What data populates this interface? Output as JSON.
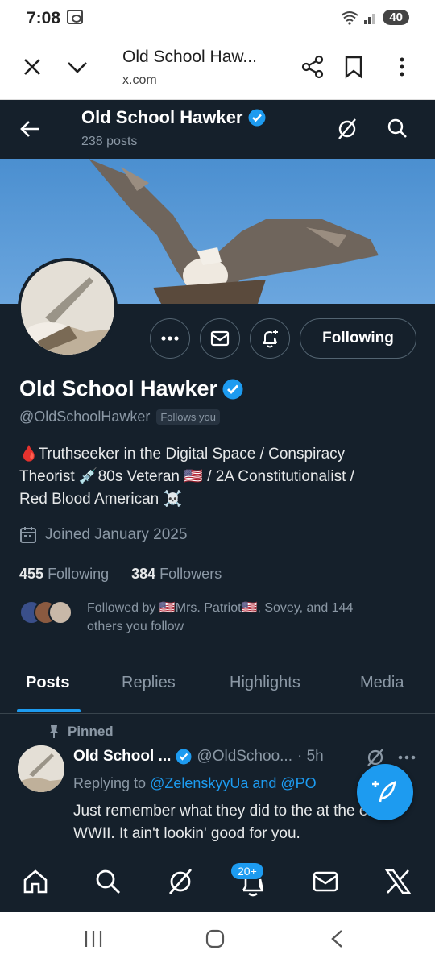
{
  "status_bar": {
    "time": "7:08",
    "battery": "40"
  },
  "browser": {
    "page_title": "Old School Haw...",
    "url": "x.com"
  },
  "profile_header": {
    "name": "Old School Hawker",
    "posts_count": "238 posts"
  },
  "profile": {
    "display_name": "Old School Hawker",
    "handle": "@OldSchoolHawker",
    "follows_you": "Follows you",
    "follow_button": "Following",
    "bio_line1": "🩸Truthseeker in the Digital Space / Conspiracy",
    "bio_line2": "Theorist 💉80s Veteran 🇺🇸 / 2A Constitutionalist /",
    "bio_line3": "Red Blood American ☠️",
    "joined": "Joined January 2025",
    "following_count": "455",
    "following_label": "Following",
    "followers_count": "384",
    "followers_label": "Followers",
    "followed_by_line1": "Followed by 🇺🇸Mrs. Patriot🇺🇸, Sovey, and 144",
    "followed_by_line2": "others you follow"
  },
  "tabs": [
    "Posts",
    "Replies",
    "Highlights",
    "Media"
  ],
  "tweet": {
    "pinned_label": "Pinned",
    "author": "Old School ...",
    "handle": "@OldSchoo...",
    "time": "· 5h",
    "replying_prefix": "Replying to ",
    "replying_to": "@ZelenskyyUa and @PO",
    "text": "Just remember what they did to the        at the end of WWII. It ain't lookin' good for you."
  },
  "bottom_nav": {
    "notifications_badge": "20+"
  },
  "colors": {
    "background": "#15202b",
    "accent": "#1d9bf0",
    "muted": "#8b98a5",
    "border": "#38444d"
  }
}
